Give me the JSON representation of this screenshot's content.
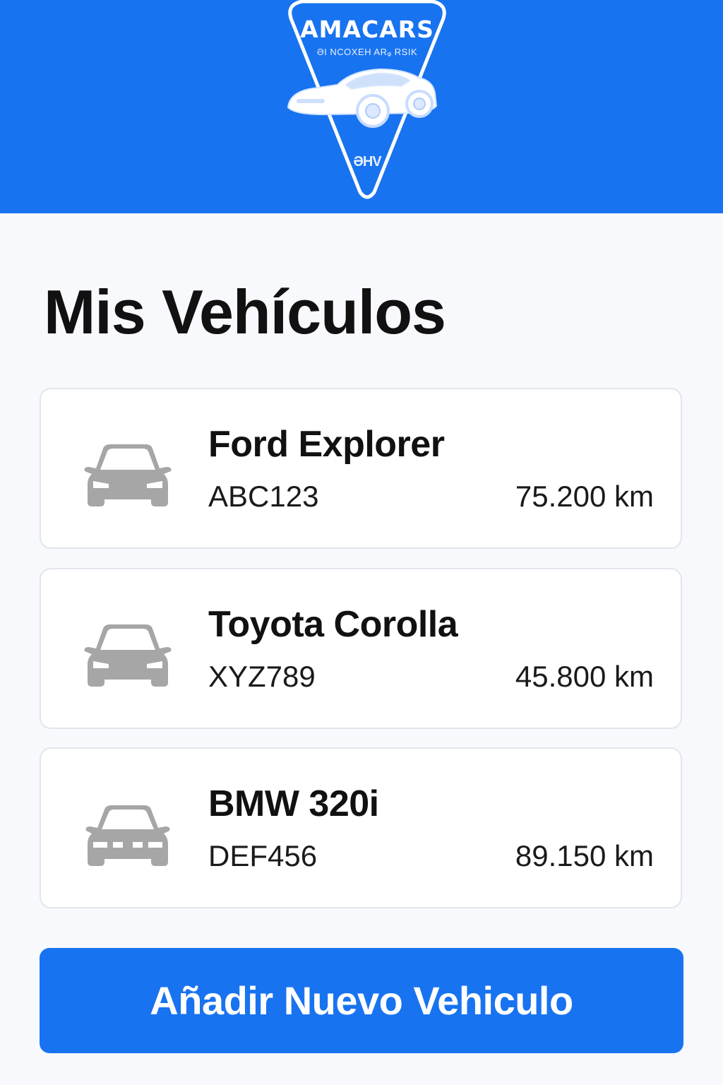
{
  "header": {
    "logo": {
      "brand": "AMACARS",
      "tagline": "ƏI NCOXEH ARᵩ RSIK",
      "mark": "ƏHV"
    }
  },
  "main": {
    "title": "Mis Vehículos",
    "vehicles": [
      {
        "name": "Ford Explorer",
        "plate": "ABC123",
        "mileage": "75.200 km",
        "icon": "car-icon"
      },
      {
        "name": "Toyota Corolla",
        "plate": "XYZ789",
        "mileage": "45.800 km",
        "icon": "car-icon"
      },
      {
        "name": "BMW 320i",
        "plate": "DEF456",
        "mileage": "89.150 km",
        "icon": "car-icon"
      }
    ],
    "add_button_label": "Añadir Nuevo Vehiculo"
  },
  "colors": {
    "primary": "#1873f0",
    "background": "#f7f9fc",
    "card_border": "#e2e6ec",
    "icon_gray": "#a6a6a6",
    "text": "#111111"
  }
}
